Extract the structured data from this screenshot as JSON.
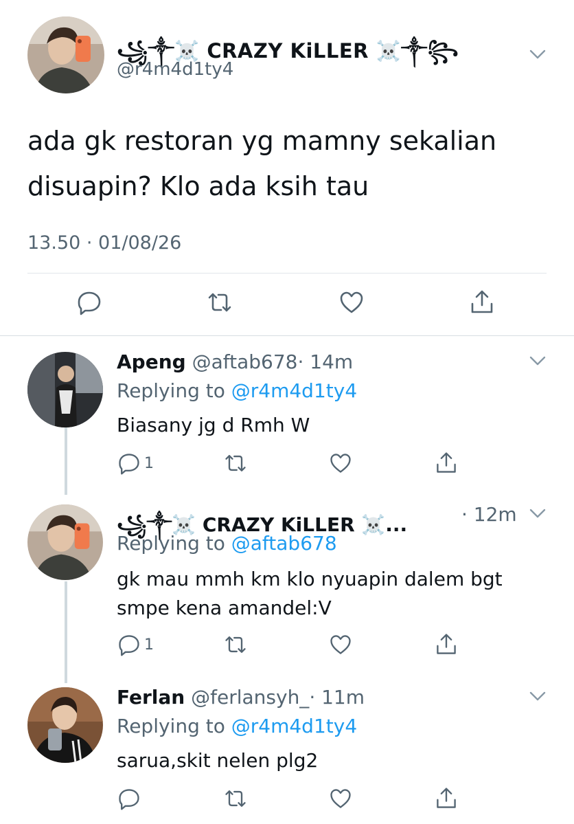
{
  "main": {
    "display_name": "꧁༒☠️ CRAZY KiLLER ☠️༒꧂",
    "handle": "@r4m4d1ty4",
    "text": "ada gk restoran yg mamny sekalian disuapin? Klo ada ksih tau",
    "timestamp": "13.50 · 01/08/26"
  },
  "replies": [
    {
      "name": "Apeng",
      "handle": "@aftab678",
      "time": "· 14m",
      "replying_label": "Replying to ",
      "replying_to": "@r4m4d1ty4",
      "text": "Biasany jg d Rmh W",
      "reply_count": "1"
    },
    {
      "name": "꧁༒☠️ CRAZY KiLLER ☠️...",
      "handle": "",
      "time": "· 12m",
      "replying_label": "Replying to ",
      "replying_to": "@aftab678",
      "text": "gk mau mmh km klo nyuapin dalem bgt smpe kena amandel:V",
      "reply_count": "1"
    },
    {
      "name": "Ferlan",
      "handle": "@ferlansyh_",
      "time": "· 11m",
      "replying_label": "Replying to ",
      "replying_to": "@r4m4d1ty4",
      "text": "sarua,skit nelen plg2",
      "reply_count": ""
    }
  ],
  "icons": {
    "reply": "reply-bubble-icon",
    "retweet": "retweet-icon",
    "like": "heart-icon",
    "share": "share-icon",
    "more": "chevron-down-icon"
  },
  "colors": {
    "text": "#0f1419",
    "secondary": "#536471",
    "link": "#1d9bf0",
    "divider": "#e1e6ea"
  }
}
